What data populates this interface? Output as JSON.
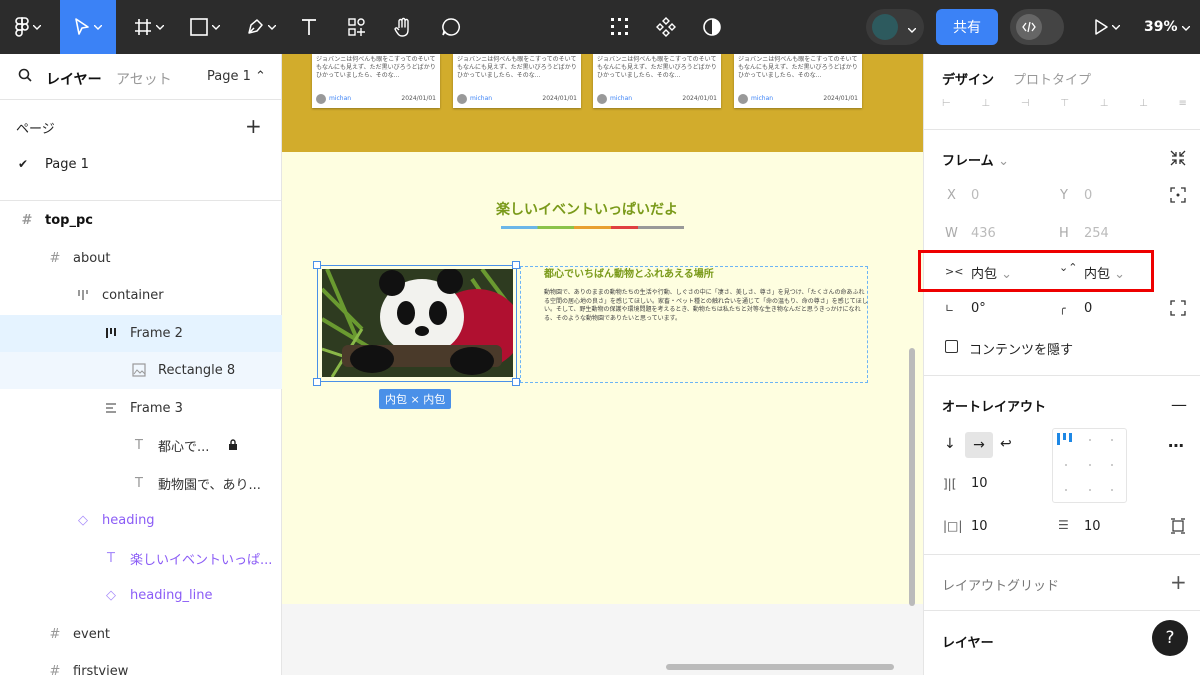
{
  "toolbar": {
    "share_label": "共有",
    "zoom_label": "39%",
    "icons": [
      "figma-menu-icon",
      "move-tool-icon",
      "frame-tool-icon",
      "shape-tool-icon",
      "pen-tool-icon",
      "text-tool-icon",
      "resources-icon",
      "hand-tool-icon",
      "comment-icon",
      "components-grid-icon",
      "component-icon",
      "contrast-icon",
      "dev-mode-icon",
      "play-icon"
    ],
    "colors": {
      "bg": "#2c2c2c",
      "active": "#3b82f6"
    }
  },
  "left_panel": {
    "tab_layers": "レイヤー",
    "tab_assets": "アセット",
    "page_selector": "Page 1",
    "pages_header": "ページ",
    "pages": [
      "Page 1"
    ],
    "layers": [
      {
        "label": "top_pc",
        "icon": "frame-icon"
      },
      {
        "label": "about",
        "icon": "frame-icon"
      },
      {
        "label": "container",
        "icon": "autolayout-vertical-icon"
      },
      {
        "label": "Frame 2",
        "icon": "autolayout-horizontal-icon"
      },
      {
        "label": "Rectangle 8",
        "icon": "image-icon"
      },
      {
        "label": "Frame 3",
        "icon": "autolayout-vertical-icon"
      },
      {
        "label": "都心で...",
        "icon": "text-icon"
      },
      {
        "label": "動物園で、あり...",
        "icon": "text-icon"
      },
      {
        "label": "heading",
        "icon": "component-instance-icon"
      },
      {
        "label": "楽しいイベントいっぱ...",
        "icon": "text-icon"
      },
      {
        "label": "heading_line",
        "icon": "component-instance-icon"
      },
      {
        "label": "event",
        "icon": "frame-icon"
      },
      {
        "label": "firstview",
        "icon": "frame-icon"
      }
    ]
  },
  "canvas": {
    "cards": [
      {
        "text": "ジョバンニは何べんも眼をこすってのそいてもなんにも見えず、ただ黒いびろうどばかりひかっていましたら、そのな...",
        "user": "michan",
        "date": "2024/01/01"
      },
      {
        "text": "ジョバンニは何べんも眼をこすってのそいてもなんにも見えず、ただ黒いびろうどばかりひかっていましたら、そのな...",
        "user": "michan",
        "date": "2024/01/01"
      },
      {
        "text": "ジョバンニは何べんも眼をこすってのそいてもなんにも見えず、ただ黒いびろうどばかりひかっていましたら、そのな...",
        "user": "michan",
        "date": "2024/01/01"
      },
      {
        "text": "ジョバンニは何べんも眼をこすってのそいてもなんにも見えず、ただ黒いびろうどばかりひかっていましたら、そのな...",
        "user": "michan",
        "date": "2024/01/01"
      }
    ],
    "heading": "楽しいイベントいっぱいだよ",
    "about_title": "都心でいちばん動物とふれあえる場所",
    "about_body": "動物園で、ありのままの動物たちの生活や行動、しぐさの中に「凄さ、美しさ、尊さ」を見つけ、「たくさんの命あふれる空間の居心地の良さ」を感じてほしい。家畜・ペット種との触れ合いを通じて「命の温もり、命の尊さ」を感じてほしい。そして、野生動物の保護や環境問題を考えるとき、動物たちは私たちと対等な生き物なんだと思うきっかけになれる、そのような動物園でありたいと思っています。",
    "size_badge": "内包 × 内包",
    "colors": {
      "yellow_band": "#d2ac2c",
      "cream": "#fefee0",
      "heading": "#7a9a1a",
      "selection": "#4a90e8"
    }
  },
  "right_panel": {
    "tab_design": "デザイン",
    "tab_prototype": "プロトタイプ",
    "frame_section": "フレーム",
    "x_label": "X",
    "x_value": "0",
    "y_label": "Y",
    "y_value": "0",
    "w_label": "W",
    "w_value": "436",
    "h_label": "H",
    "h_value": "254",
    "width_mode": "内包",
    "height_mode": "内包",
    "rotation": "0°",
    "radius": "0",
    "hide_content_label": "コンテンツを隠す",
    "autolayout_section": "オートレイアウト",
    "gap": "10",
    "padding_h": "10",
    "padding_v": "10",
    "layout_grid_section": "レイアウトグリッド",
    "layer_section": "レイヤー",
    "help": "?",
    "colors": {
      "highlight": "#e00000"
    }
  }
}
